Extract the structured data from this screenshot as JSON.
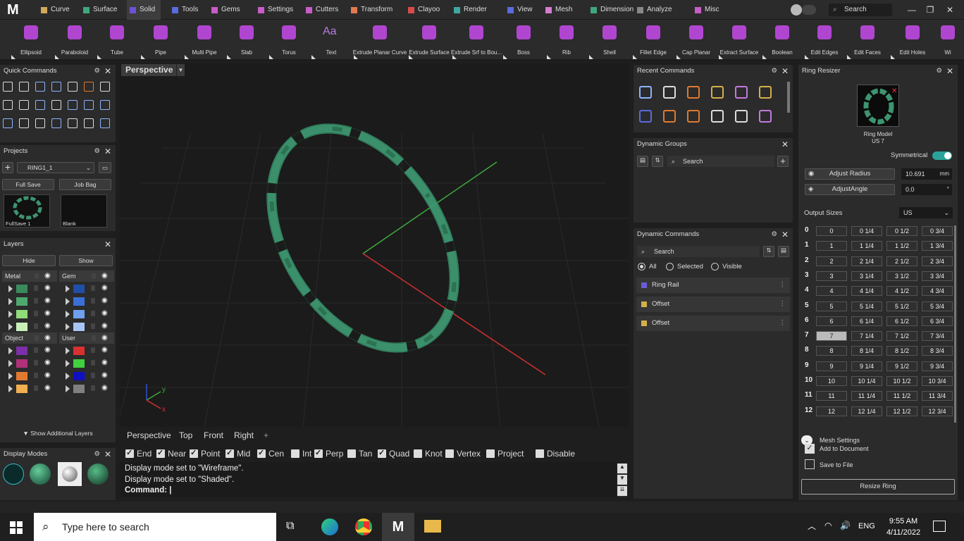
{
  "menu_tabs": [
    {
      "label": "Curve",
      "color": "#d2a85a"
    },
    {
      "label": "Surface",
      "color": "#3fa77e"
    },
    {
      "label": "Solid",
      "color": "#6d52d6"
    },
    {
      "label": "Tools",
      "color": "#5a6bdc"
    },
    {
      "label": "Gems",
      "color": "#c85cc8"
    },
    {
      "label": "Settings",
      "color": "#c85cc8"
    },
    {
      "label": "Cutters",
      "color": "#c85cc8"
    },
    {
      "label": "Transform",
      "color": "#e07a4e"
    },
    {
      "label": "Clayoo",
      "color": "#d94b4b"
    },
    {
      "label": "Render",
      "color": "#3fa7a0"
    },
    {
      "label": "View",
      "color": "#5a6bdc"
    },
    {
      "label": "Mesh",
      "color": "#d47cd4"
    },
    {
      "label": "Dimension",
      "color": "#3fa77e"
    },
    {
      "label": "Analyze",
      "color": "#888888"
    },
    {
      "label": "Misc",
      "color": "#c85cc8"
    }
  ],
  "active_tab": "Solid",
  "top_search": "Search",
  "ribbon": [
    "Ellipsoid",
    "Paraboloid",
    "Tube",
    "Pipe",
    "Multi Pipe",
    "Slab",
    "Torus",
    "Text",
    "Extrude Planar Curve",
    "Extrude Surface",
    "Extrude Srf to Bou...",
    "Boss",
    "Rib",
    "Shell",
    "Fillet Edge",
    "Cap Planar",
    "Extract Surface",
    "Boolean",
    "Edit Edges",
    "Edit Faces",
    "Edit Holes",
    "Wi"
  ],
  "text_icon": "Aa",
  "quick_commands": {
    "title": "Quick Commands"
  },
  "projects": {
    "title": "Projects",
    "project": "RING1_1",
    "full_save": "Full Save",
    "job_bag": "Job Bag",
    "thumb1": "FullSave 1",
    "thumb2": "Blank"
  },
  "layers": {
    "title": "Layers",
    "hide": "Hide",
    "show": "Show",
    "groups": [
      {
        "name": "Metal",
        "colors": [
          "#3a8a5c",
          "#4ea86e",
          "#8fdc7a",
          "#c9f0b8"
        ]
      },
      {
        "name": "Gem",
        "colors": [
          "#1f4fa8",
          "#3b6fd8",
          "#6fa0ee",
          "#a8c4f4"
        ]
      },
      {
        "name": "Object",
        "colors": [
          "#7b2fa8",
          "#b0307a",
          "#e07a30",
          "#f0b050"
        ]
      },
      {
        "name": "User",
        "colors": [
          "#d93030",
          "#40d040",
          "#1010c0",
          "#808080"
        ]
      }
    ],
    "additional": "Show Additional Layers"
  },
  "display_modes": {
    "title": "Display Modes"
  },
  "viewport": {
    "title": "Perspective",
    "tabs": [
      "Perspective",
      "Top",
      "Front",
      "Right"
    ]
  },
  "snaps": [
    {
      "label": "End",
      "on": true
    },
    {
      "label": "Near",
      "on": true
    },
    {
      "label": "Point",
      "on": true
    },
    {
      "label": "Mid",
      "on": true
    },
    {
      "label": "Cen",
      "on": true
    },
    {
      "label": "Int",
      "on": false
    },
    {
      "label": "Perp",
      "on": true
    },
    {
      "label": "Tan",
      "on": false
    },
    {
      "label": "Quad",
      "on": true
    },
    {
      "label": "Knot",
      "on": false
    },
    {
      "label": "Vertex",
      "on": false
    },
    {
      "label": "Project",
      "on": false
    },
    {
      "label": "Disable",
      "on": false
    }
  ],
  "command_log": [
    "Display mode set to \"Wireframe\".",
    "Display mode set to \"Shaded\"."
  ],
  "command_prompt": "Command:",
  "recent_commands": {
    "title": "Recent Commands"
  },
  "dynamic_groups": {
    "title": "Dynamic Groups",
    "search": "Search"
  },
  "dynamic_commands": {
    "title": "Dynamic Commands",
    "search": "Search",
    "filters": [
      "All",
      "Selected",
      "Visible"
    ],
    "items": [
      {
        "label": "Ring Rail",
        "color": "#6a5cd6"
      },
      {
        "label": "Offset",
        "color": "#d4b04a"
      },
      {
        "label": "Offset",
        "color": "#d4b04a"
      }
    ]
  },
  "ring_resizer": {
    "title": "Ring Resizer",
    "model": "Ring Model",
    "size": "US 7",
    "symmetrical": "Symmetrical",
    "adjust_radius": "Adjust Radius",
    "radius_value": "10.691",
    "radius_unit": "mm",
    "adjust_angle": "AdjustAngle",
    "angle_value": "0.0",
    "angle_unit": "°",
    "output_sizes": "Output Sizes",
    "standard": "US",
    "sizes": [
      [
        "0",
        "0",
        "0 1/4",
        "0 1/2",
        "0 3/4"
      ],
      [
        "1",
        "1",
        "1 1/4",
        "1 1/2",
        "1 3/4"
      ],
      [
        "2",
        "2",
        "2 1/4",
        "2 1/2",
        "2 3/4"
      ],
      [
        "3",
        "3",
        "3 1/4",
        "3 1/2",
        "3 3/4"
      ],
      [
        "4",
        "4",
        "4 1/4",
        "4 1/2",
        "4 3/4"
      ],
      [
        "5",
        "5",
        "5 1/4",
        "5 1/2",
        "5 3/4"
      ],
      [
        "6",
        "6",
        "6 1/4",
        "6 1/2",
        "6 3/4"
      ],
      [
        "7",
        "7",
        "7 1/4",
        "7 1/2",
        "7 3/4"
      ],
      [
        "8",
        "8",
        "8 1/4",
        "8 1/2",
        "8 3/4"
      ],
      [
        "9",
        "9",
        "9 1/4",
        "9 1/2",
        "9 3/4"
      ],
      [
        "10",
        "10",
        "10 1/4",
        "10 1/2",
        "10 3/4"
      ],
      [
        "11",
        "11",
        "11 1/4",
        "11 1/2",
        "11 3/4"
      ],
      [
        "12",
        "12",
        "12 1/4",
        "12 1/2",
        "12 3/4"
      ]
    ],
    "selected": "7",
    "mesh_settings": "Mesh Settings",
    "add_to_doc": "Add to Document",
    "save_to_file": "Save to File",
    "resize": "Resize Ring"
  },
  "taskbar": {
    "search": "Type here to search",
    "lang": "ENG",
    "time": "9:55 AM",
    "date": "4/11/2022"
  }
}
